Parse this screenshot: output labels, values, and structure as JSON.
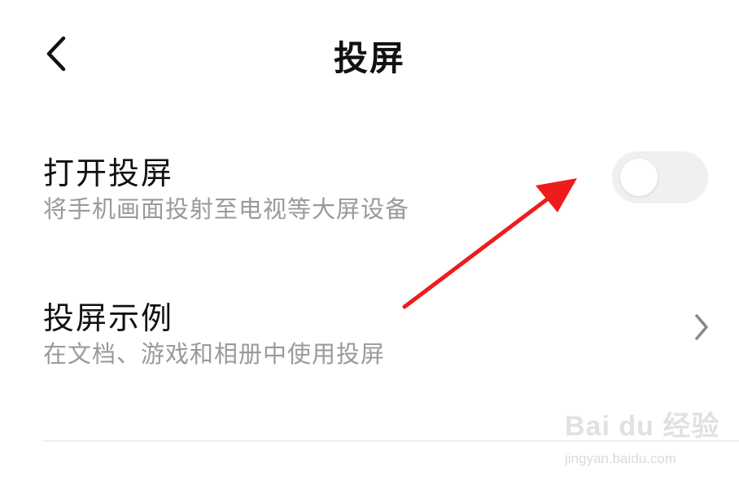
{
  "header": {
    "title": "投屏",
    "back_icon": "chevron-left-icon"
  },
  "settings": [
    {
      "title": "打开投屏",
      "subtitle": "将手机画面投射至电视等大屏设备",
      "control": "toggle",
      "toggle_on": false
    },
    {
      "title": "投屏示例",
      "subtitle": "在文档、游戏和相册中使用投屏",
      "control": "chevron-right-icon"
    }
  ],
  "annotation": {
    "arrow_color": "#ee1c1c",
    "points_to": "toggle"
  },
  "watermark": {
    "brand": "Bai du 经验",
    "url": "jingyan.baidu.com"
  },
  "colors": {
    "title": "#111111",
    "subtitle": "#9a9a9a",
    "toggle_track": "#f0f0f0",
    "divider": "#ececec"
  }
}
